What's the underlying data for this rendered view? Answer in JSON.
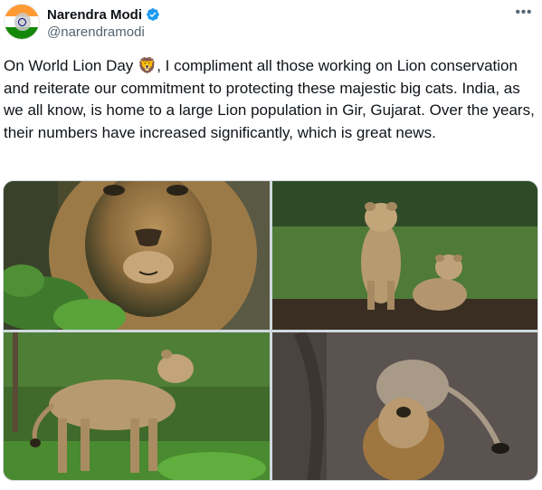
{
  "author": {
    "display_name": "Narendra Modi",
    "handle": "@narendramodi",
    "verified": true,
    "avatar_icon": "profile-avatar-flag"
  },
  "tweet": {
    "text": "On World Lion Day 🦁, I compliment all those working on Lion conservation and reiterate our commitment to protecting these majestic big cats. India, as we all know, is home to a large Lion population in Gir, Gujarat. Over the years, their numbers have increased significantly, which is great news."
  },
  "menu": {
    "more_label": "•••"
  },
  "media": {
    "count": 4,
    "photos": [
      "lion-face-closeup",
      "two-lion-cubs",
      "lioness-standing",
      "lion-roaring"
    ]
  },
  "colors": {
    "text_primary": "#0f1419",
    "text_secondary": "#536471",
    "verified_blue": "#1d9bf0",
    "border": "#cfd9de"
  }
}
